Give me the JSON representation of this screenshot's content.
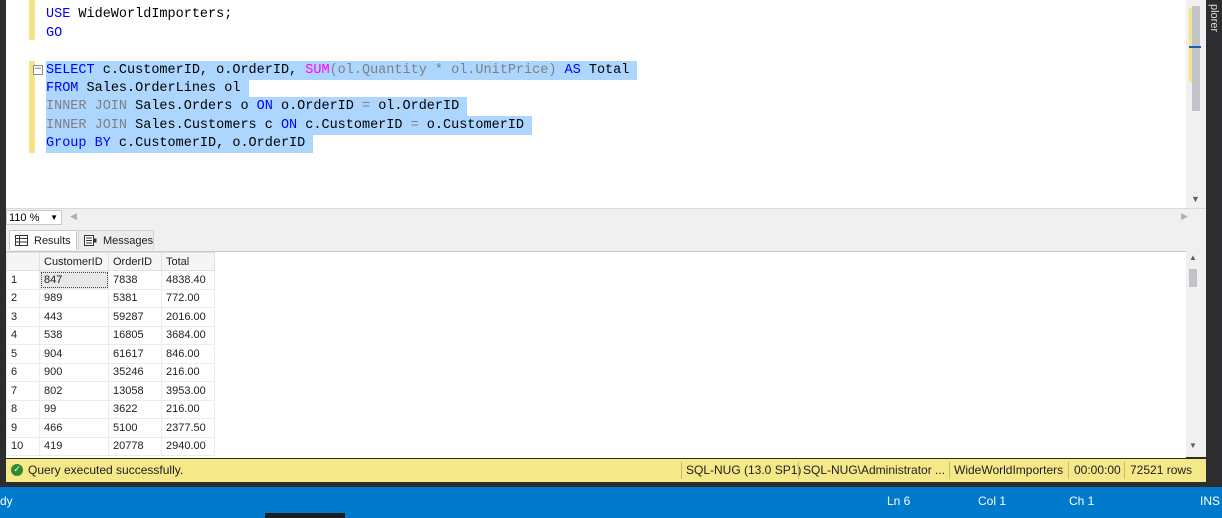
{
  "editor": {
    "lines": [
      [
        {
          "t": "USE ",
          "c": "kw"
        },
        {
          "t": "WideWorldImporters;",
          "c": ""
        }
      ],
      [
        {
          "t": "GO",
          "c": "kw"
        }
      ],
      [],
      [
        {
          "t": "SELECT ",
          "c": "kw"
        },
        {
          "t": "c.CustomerID, o.OrderID, ",
          "c": ""
        },
        {
          "t": "SUM",
          "c": "fn"
        },
        {
          "t": "(ol.Quantity ",
          "c": "gr"
        },
        {
          "t": "* ",
          "c": "gr"
        },
        {
          "t": "ol.UnitPrice) ",
          "c": "gr"
        },
        {
          "t": "AS ",
          "c": "kw"
        },
        {
          "t": "Total",
          "c": ""
        }
      ],
      [
        {
          "t": "FROM ",
          "c": "kw"
        },
        {
          "t": "Sales.OrderLines ol",
          "c": ""
        }
      ],
      [
        {
          "t": "INNER JOIN ",
          "c": "gr"
        },
        {
          "t": "Sales.Orders o ",
          "c": ""
        },
        {
          "t": "ON ",
          "c": "kw"
        },
        {
          "t": "o.OrderID ",
          "c": ""
        },
        {
          "t": "= ",
          "c": "gr"
        },
        {
          "t": "ol.OrderID",
          "c": ""
        }
      ],
      [
        {
          "t": "INNER JOIN ",
          "c": "gr"
        },
        {
          "t": "Sales.Customers c ",
          "c": ""
        },
        {
          "t": "ON ",
          "c": "kw"
        },
        {
          "t": "c.CustomerID ",
          "c": ""
        },
        {
          "t": "= ",
          "c": "gr"
        },
        {
          "t": "o.CustomerID",
          "c": ""
        }
      ],
      [
        {
          "t": "Group BY ",
          "c": "kw"
        },
        {
          "t": "c.CustomerID, o.OrderID",
          "c": ""
        }
      ]
    ]
  },
  "side_panel_label": "plorer",
  "zoom": {
    "value": "110 %"
  },
  "tabs": {
    "results": "Results",
    "messages": "Messages"
  },
  "grid": {
    "columns": [
      "CustomerID",
      "OrderID",
      "Total"
    ],
    "rows": [
      [
        "1",
        "847",
        "7838",
        "4838.40"
      ],
      [
        "2",
        "989",
        "5381",
        "772.00"
      ],
      [
        "3",
        "443",
        "59287",
        "2016.00"
      ],
      [
        "4",
        "538",
        "16805",
        "3684.00"
      ],
      [
        "5",
        "904",
        "61617",
        "846.00"
      ],
      [
        "6",
        "900",
        "35246",
        "216.00"
      ],
      [
        "7",
        "802",
        "13058",
        "3953.00"
      ],
      [
        "8",
        "99",
        "3622",
        "216.00"
      ],
      [
        "9",
        "466",
        "5100",
        "2377.50"
      ],
      [
        "10",
        "419",
        "20778",
        "2940.00"
      ]
    ]
  },
  "query_status": {
    "message": "Query executed successfully.",
    "server": "SQL-NUG (13.0 SP1)",
    "user": "SQL-NUG\\Administrator ...",
    "database": "WideWorldImporters",
    "elapsed": "00:00:00",
    "rows": "72521 rows"
  },
  "statusbar": {
    "left": "dy",
    "ln": "Ln 6",
    "col": "Col 1",
    "ch": "Ch 1",
    "mode": "INS"
  },
  "colors": {
    "selection": "#add6ff",
    "keyword": "#0000ff",
    "function": "#ff00ff",
    "status_yellow": "#f5e889",
    "statusbar_blue": "#007acc"
  }
}
